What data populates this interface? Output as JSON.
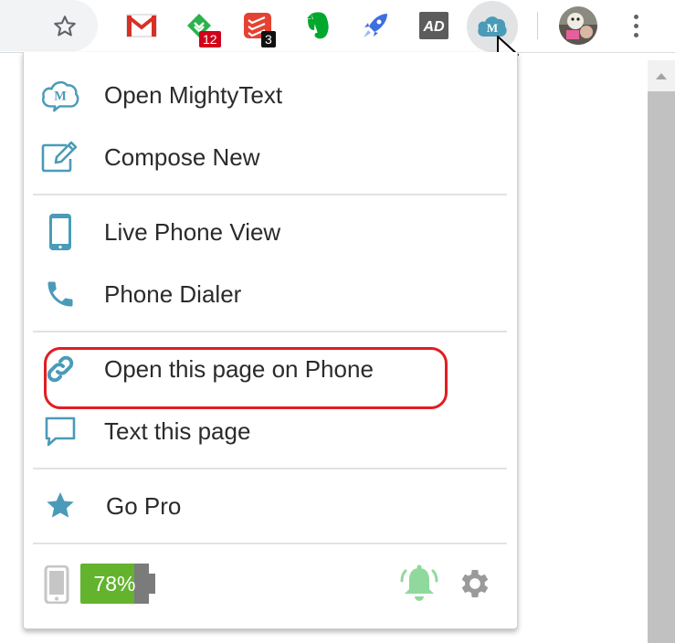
{
  "toolbar": {
    "extensions": [
      {
        "name": "gmail",
        "badge": ""
      },
      {
        "name": "feedly",
        "badge": "12"
      },
      {
        "name": "todoist",
        "badge": "3"
      },
      {
        "name": "evernote",
        "badge": ""
      },
      {
        "name": "rocket",
        "badge": ""
      },
      {
        "name": "ad",
        "badge": ""
      },
      {
        "name": "mightytext",
        "badge": ""
      }
    ],
    "badges": {
      "feedly": "12",
      "todoist": "3"
    }
  },
  "menu": {
    "open_mightytext": "Open MightyText",
    "compose_new": "Compose New",
    "live_phone_view": "Live Phone View",
    "phone_dialer": "Phone Dialer",
    "open_page_on_phone": "Open this page on Phone",
    "text_this_page": "Text this page",
    "go_pro": "Go Pro"
  },
  "footer": {
    "battery_percent": "78%",
    "battery_level": 0.78
  },
  "colors": {
    "icon_teal": "#4a9bb8",
    "highlight_red": "#e11d23",
    "battery_green": "#63b32e",
    "bell_green": "#8fd99c"
  },
  "icons": {
    "logo": "mightytext-cloud-icon",
    "compose": "edit-icon",
    "live_view": "smartphone-icon",
    "dialer": "phone-icon",
    "link": "link-icon",
    "text": "chat-icon",
    "pro": "star-icon",
    "device": "phone-device-icon",
    "bell": "bell-icon",
    "settings": "gear-icon"
  }
}
